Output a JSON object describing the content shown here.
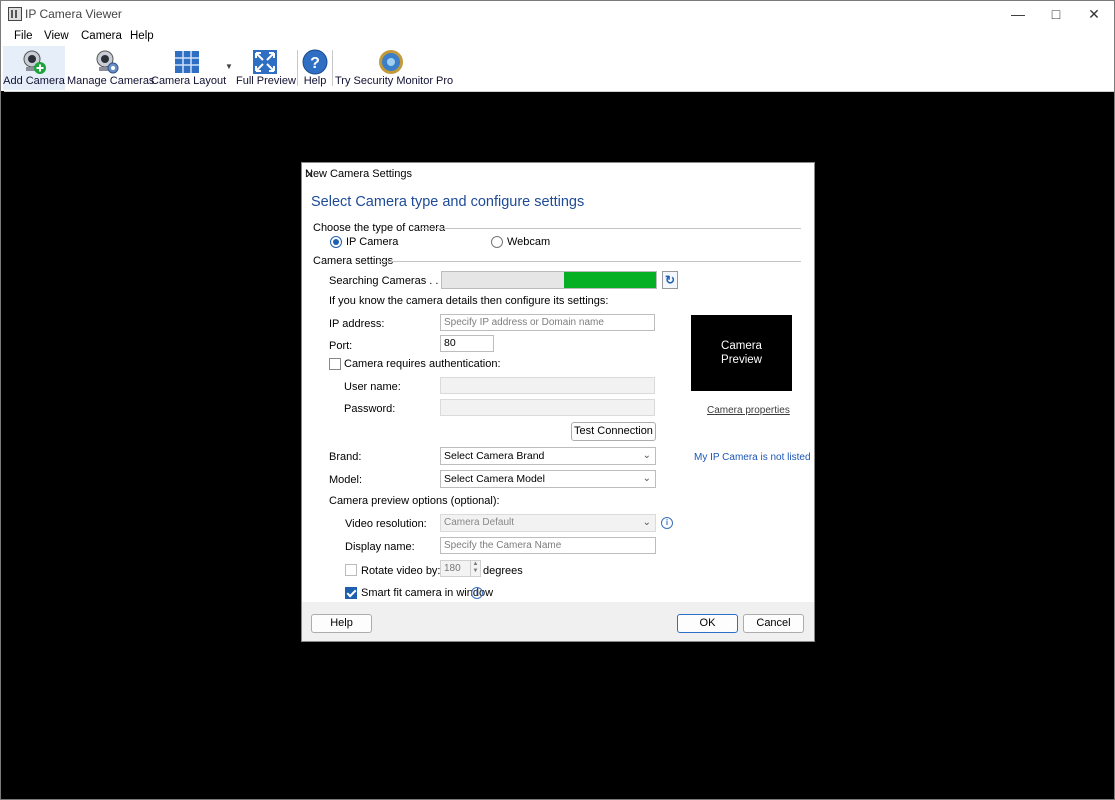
{
  "window": {
    "title": "IP Camera Viewer"
  },
  "menu": [
    "File",
    "View",
    "Camera",
    "Help"
  ],
  "toolbar": {
    "add_camera": "Add Camera",
    "manage_cameras": "Manage Cameras",
    "camera_layout": "Camera Layout",
    "full_preview": "Full Preview",
    "help": "Help",
    "try_pro": "Try Security Monitor Pro"
  },
  "dialog": {
    "title": "New Camera Settings",
    "heading": "Select Camera type and configure settings",
    "type_group": "Choose the type of camera",
    "ip_camera": "IP Camera",
    "webcam": "Webcam",
    "settings_group": "Camera settings",
    "searching": "Searching Cameras . . .",
    "search_progress": 0.43,
    "hint": "If you know the camera details then configure its settings:",
    "ip_label": "IP address:",
    "ip_placeholder": "Specify IP address or Domain name",
    "port_label": "Port:",
    "port_value": "80",
    "auth_label": "Camera requires authentication:",
    "user_label": "User name:",
    "password_label": "Password:",
    "test_connection": "Test Connection",
    "preview_text": "Camera Preview",
    "camera_properties": "Camera properties",
    "brand_label": "Brand:",
    "brand_value": "Select Camera Brand",
    "not_listed": "My IP Camera is not listed",
    "model_label": "Model:",
    "model_value": "Select Camera Model",
    "preview_options": "Camera preview options (optional):",
    "video_res_label": "Video resolution:",
    "video_res_value": "Camera Default",
    "display_name_label": "Display name:",
    "display_name_placeholder": "Specify the Camera Name",
    "rotate_label": "Rotate video by:",
    "rotate_value": "180",
    "degrees": "degrees",
    "smart_fit": "Smart fit camera in window",
    "help_btn": "Help",
    "ok_btn": "OK",
    "cancel_btn": "Cancel"
  },
  "colors": {
    "accent": "#1e4b98",
    "progress": "#06b025",
    "link": "#1a56b5"
  }
}
